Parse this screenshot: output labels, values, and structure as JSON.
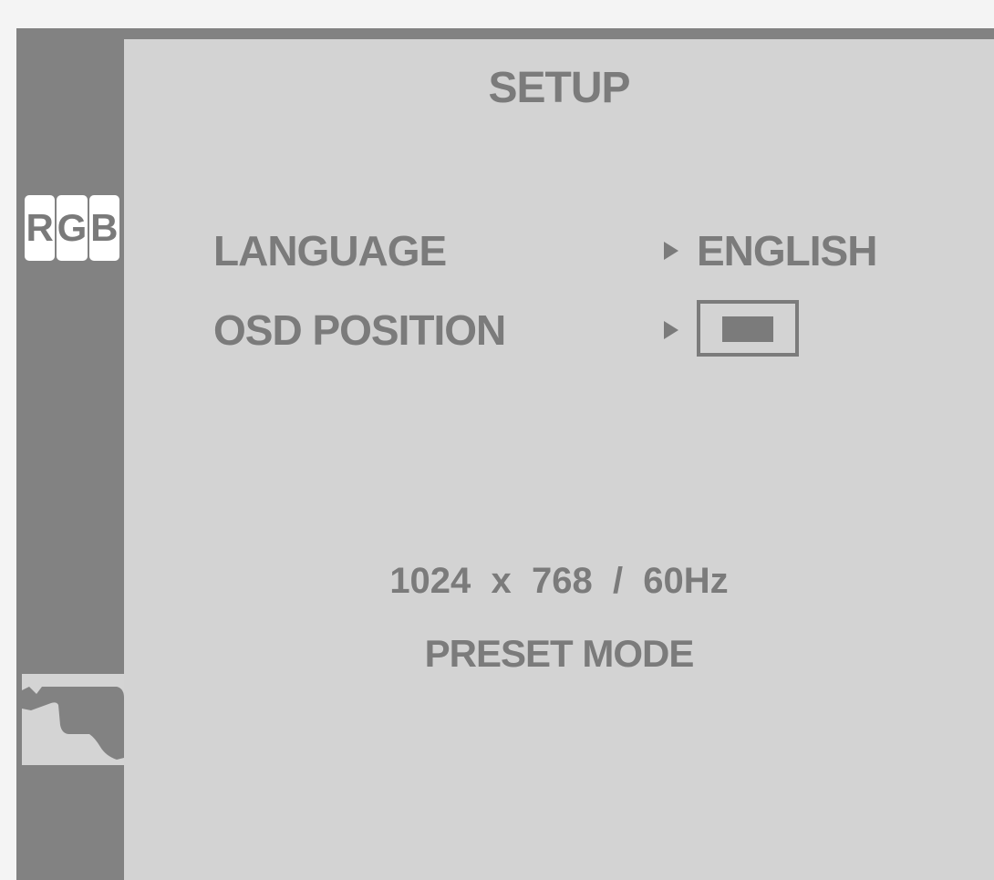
{
  "sidebar": {
    "input_icon": [
      "R",
      "G",
      "B"
    ],
    "active_tab_icon": "setup-tab-icon"
  },
  "menu": {
    "title": "SETUP",
    "rows": [
      {
        "label": "LANGUAGE",
        "value": "ENGLISH"
      },
      {
        "label": "OSD POSITION",
        "value": ""
      }
    ]
  },
  "status": {
    "resolution": "1024  x  768  /  60Hz",
    "mode": "PRESET MODE"
  },
  "colors": {
    "frame": "#828282",
    "panel": "#d3d3d3",
    "text": "#7b7b7b"
  }
}
